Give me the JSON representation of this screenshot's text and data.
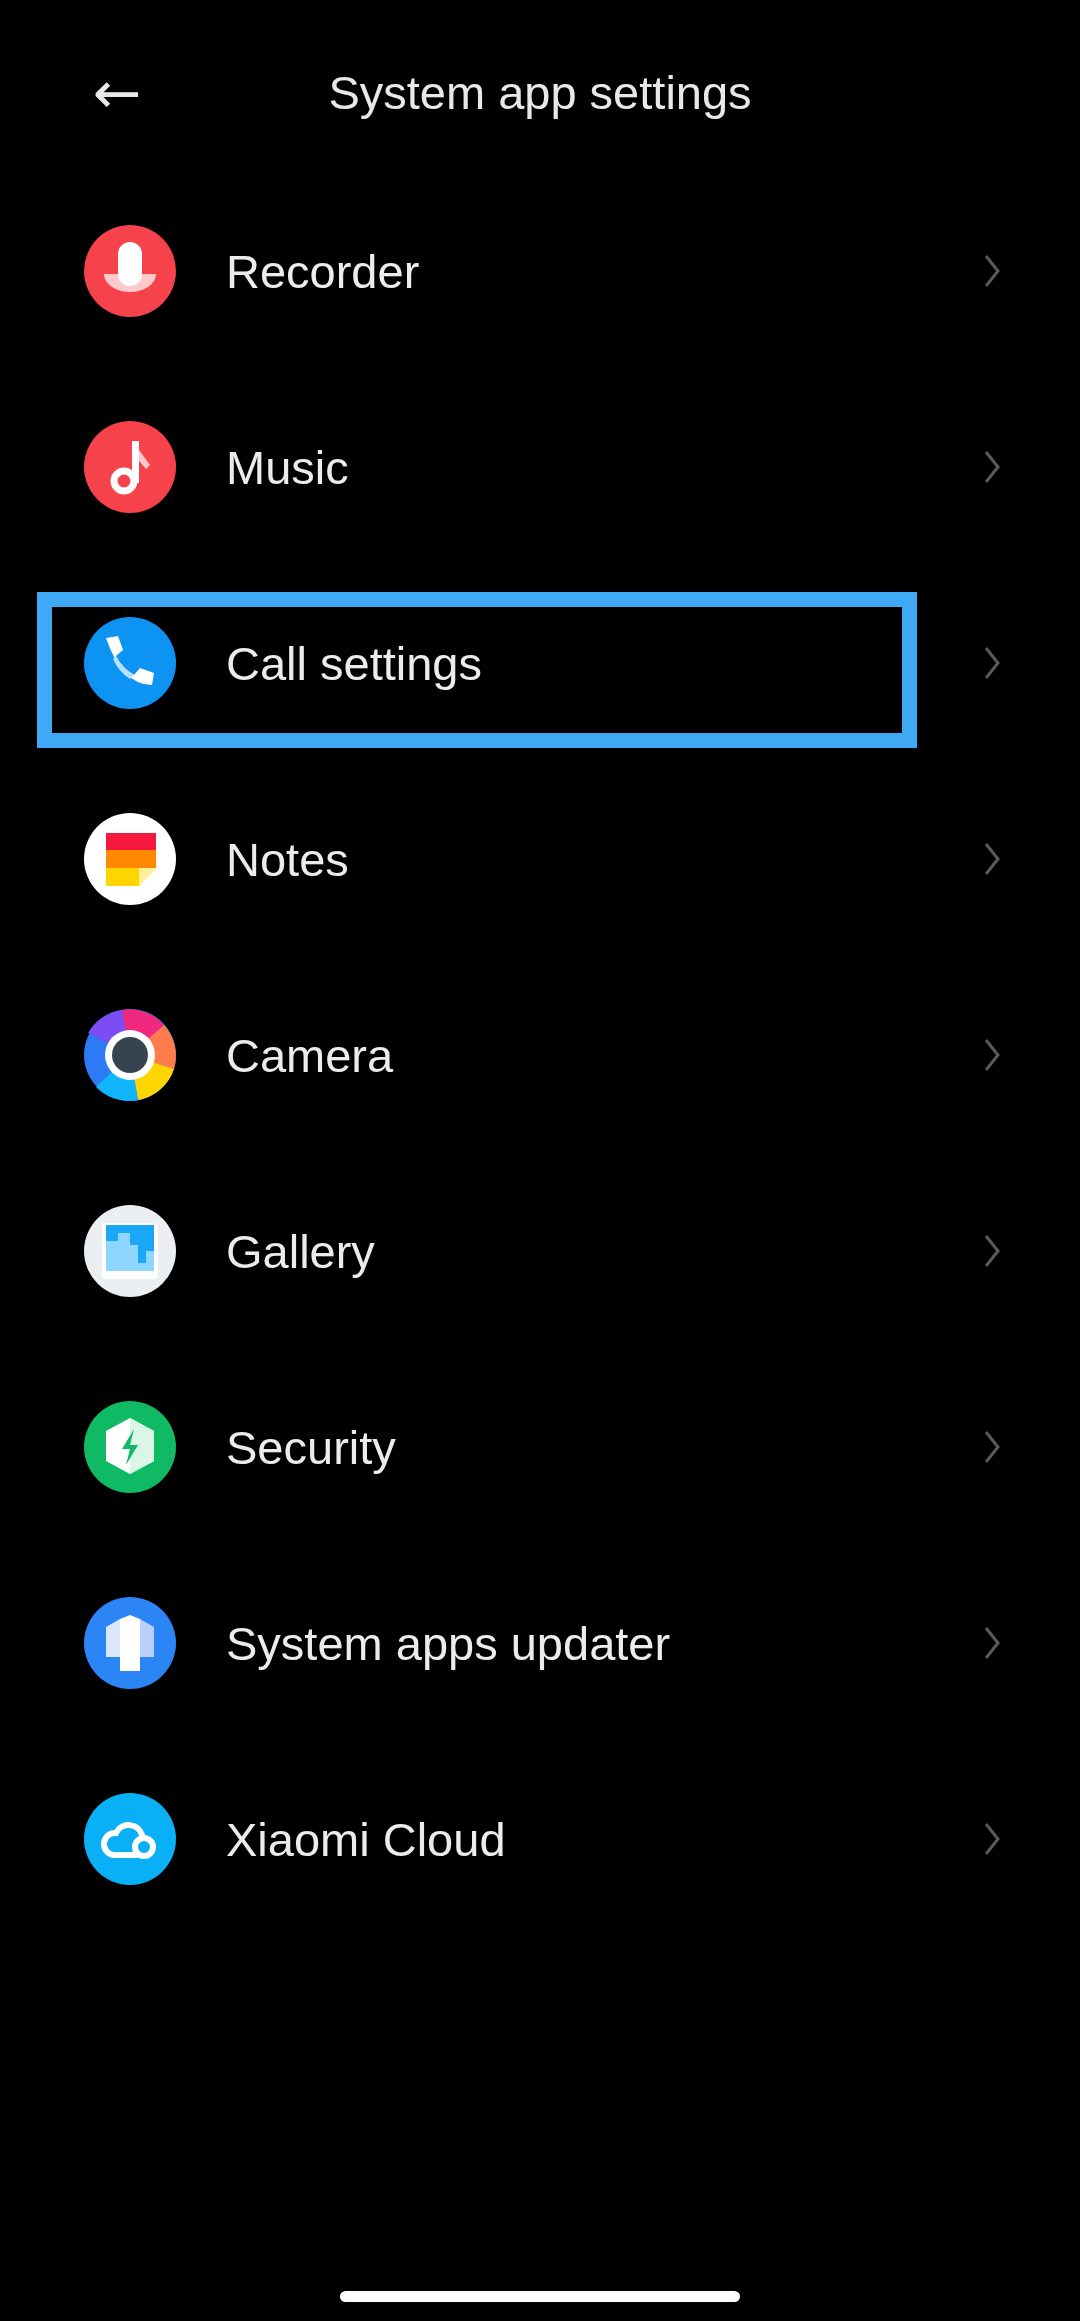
{
  "header": {
    "back": "←",
    "title": "System app settings"
  },
  "items": [
    {
      "label": "Recorder",
      "highlighted": false
    },
    {
      "label": "Music",
      "highlighted": false
    },
    {
      "label": "Call settings",
      "highlighted": true
    },
    {
      "label": "Notes",
      "highlighted": false
    },
    {
      "label": "Camera",
      "highlighted": false
    },
    {
      "label": "Gallery",
      "highlighted": false
    },
    {
      "label": "Security",
      "highlighted": false
    },
    {
      "label": "System apps updater",
      "highlighted": false
    },
    {
      "label": "Xiaomi Cloud",
      "highlighted": false
    }
  ]
}
